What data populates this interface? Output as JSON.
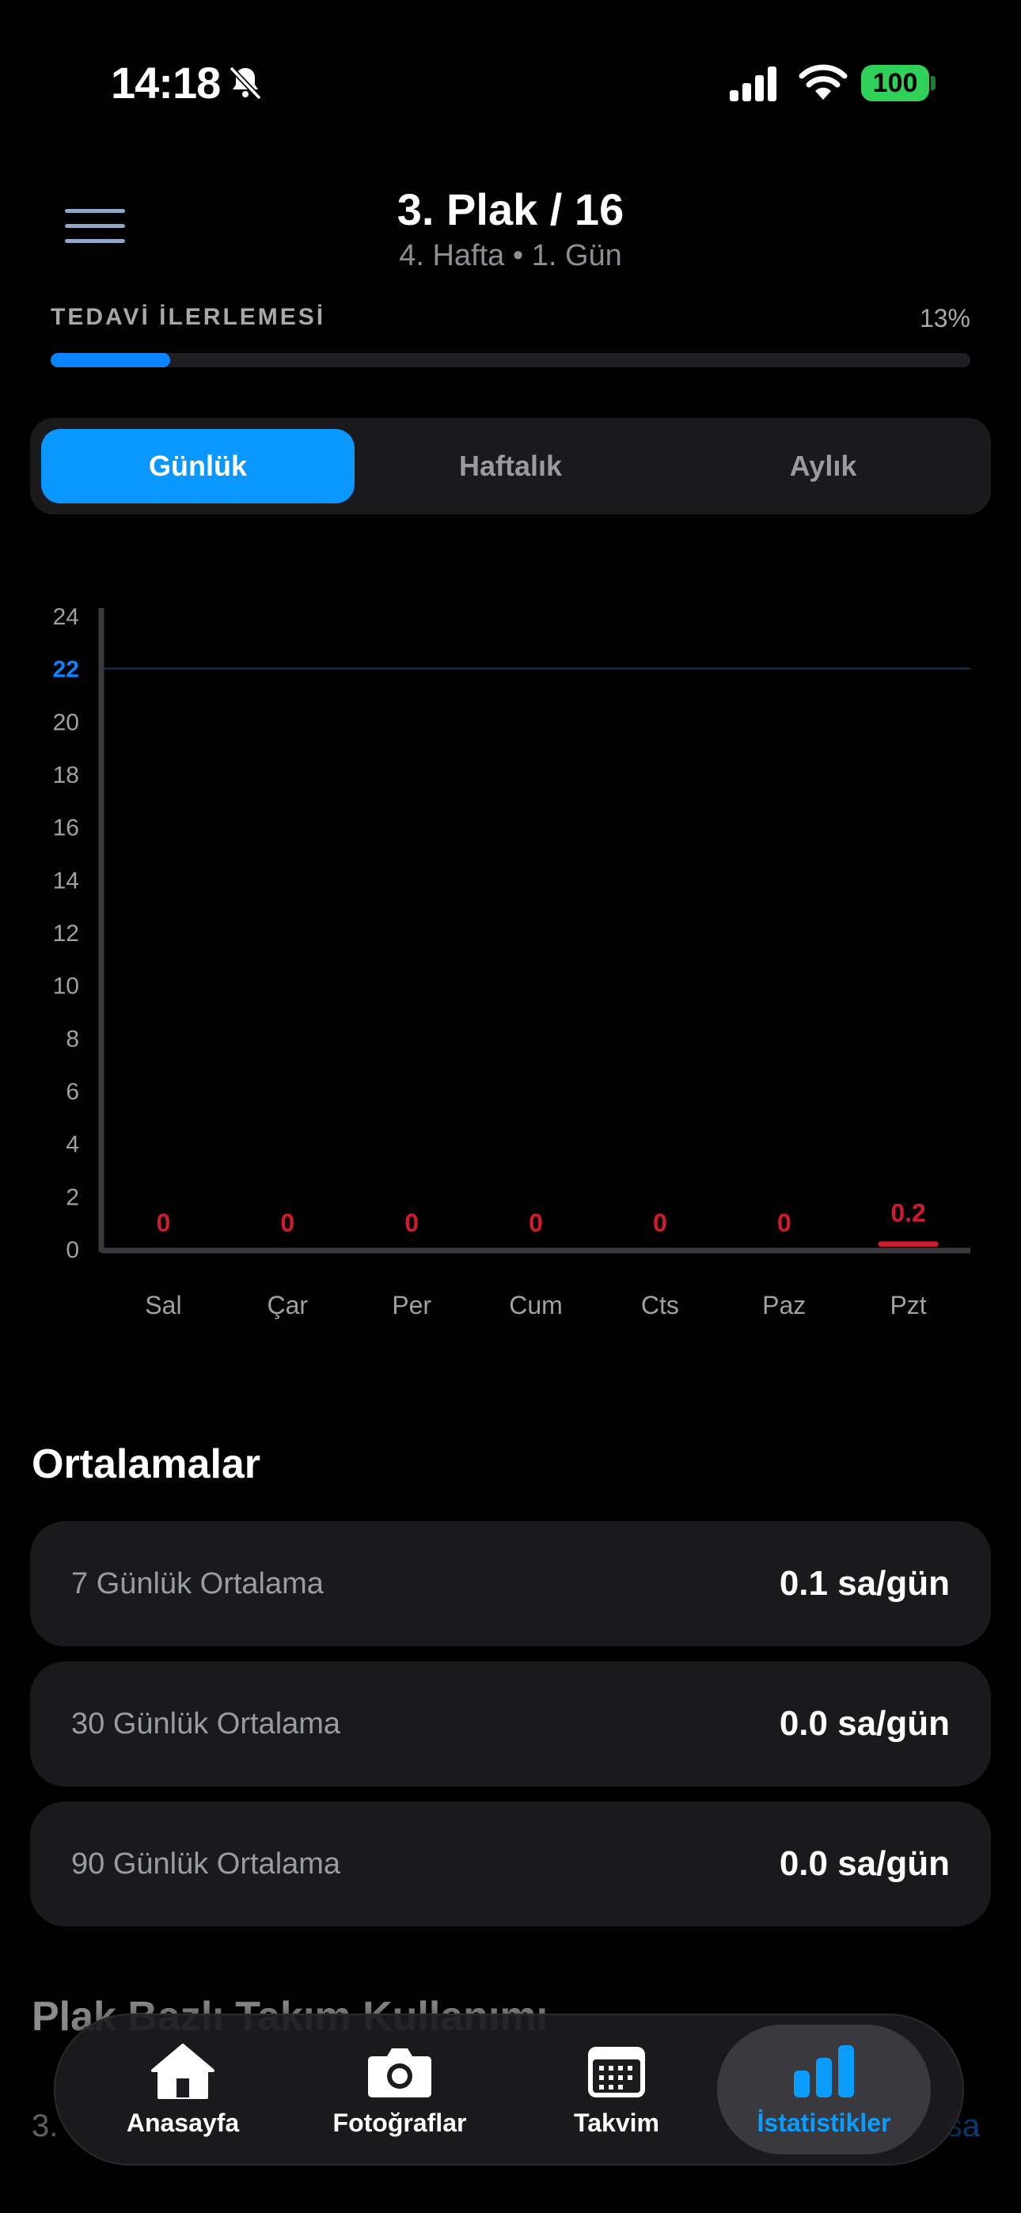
{
  "status_bar": {
    "time": "14:18",
    "battery": "100"
  },
  "header": {
    "title": "3. Plak / 16",
    "subtitle": "4. Hafta • 1. Gün"
  },
  "progress": {
    "label": "TEDAVİ İLERLEMESİ",
    "percent_text": "13%",
    "fraction": 0.13
  },
  "segments": {
    "daily": "Günlük",
    "weekly": "Haftalık",
    "monthly": "Aylık",
    "selected": "Günlük"
  },
  "chart_data": {
    "type": "bar",
    "categories": [
      "Sal",
      "Çar",
      "Per",
      "Cum",
      "Cts",
      "Paz",
      "Pzt"
    ],
    "values": [
      0,
      0,
      0,
      0,
      0,
      0,
      0.2
    ],
    "value_labels": [
      "0",
      "0",
      "0",
      "0",
      "0",
      "0",
      "0.2"
    ],
    "y_ticks": [
      "0",
      "2",
      "4",
      "6",
      "8",
      "10",
      "12",
      "14",
      "16",
      "18",
      "20",
      "22",
      "24"
    ],
    "ylim": [
      0,
      24
    ],
    "target_line": 22,
    "colors": {
      "target": "#0a84ff",
      "bars": "#d01a2e"
    }
  },
  "averages": {
    "title": "Ortalamalar",
    "items": [
      {
        "label": "7 Günlük Ortalama",
        "value": "0.1 sa/gün"
      },
      {
        "label": "30 Günlük Ortalama",
        "value": "0.0 sa/gün"
      },
      {
        "label": "90 Günlük Ortalama",
        "value": "0.0 sa/gün"
      }
    ]
  },
  "peek": {
    "title": "Plak Bazlı Takım Kullanımı",
    "row_text": "3.",
    "row_link": "sa"
  },
  "tabbar": {
    "items": [
      {
        "label": "Anasayfa",
        "icon": "home-icon"
      },
      {
        "label": "Fotoğraflar",
        "icon": "camera-icon"
      },
      {
        "label": "Takvim",
        "icon": "calendar-icon"
      },
      {
        "label": "İstatistikler",
        "icon": "chart-icon"
      }
    ],
    "selected": "İstatistikler"
  }
}
